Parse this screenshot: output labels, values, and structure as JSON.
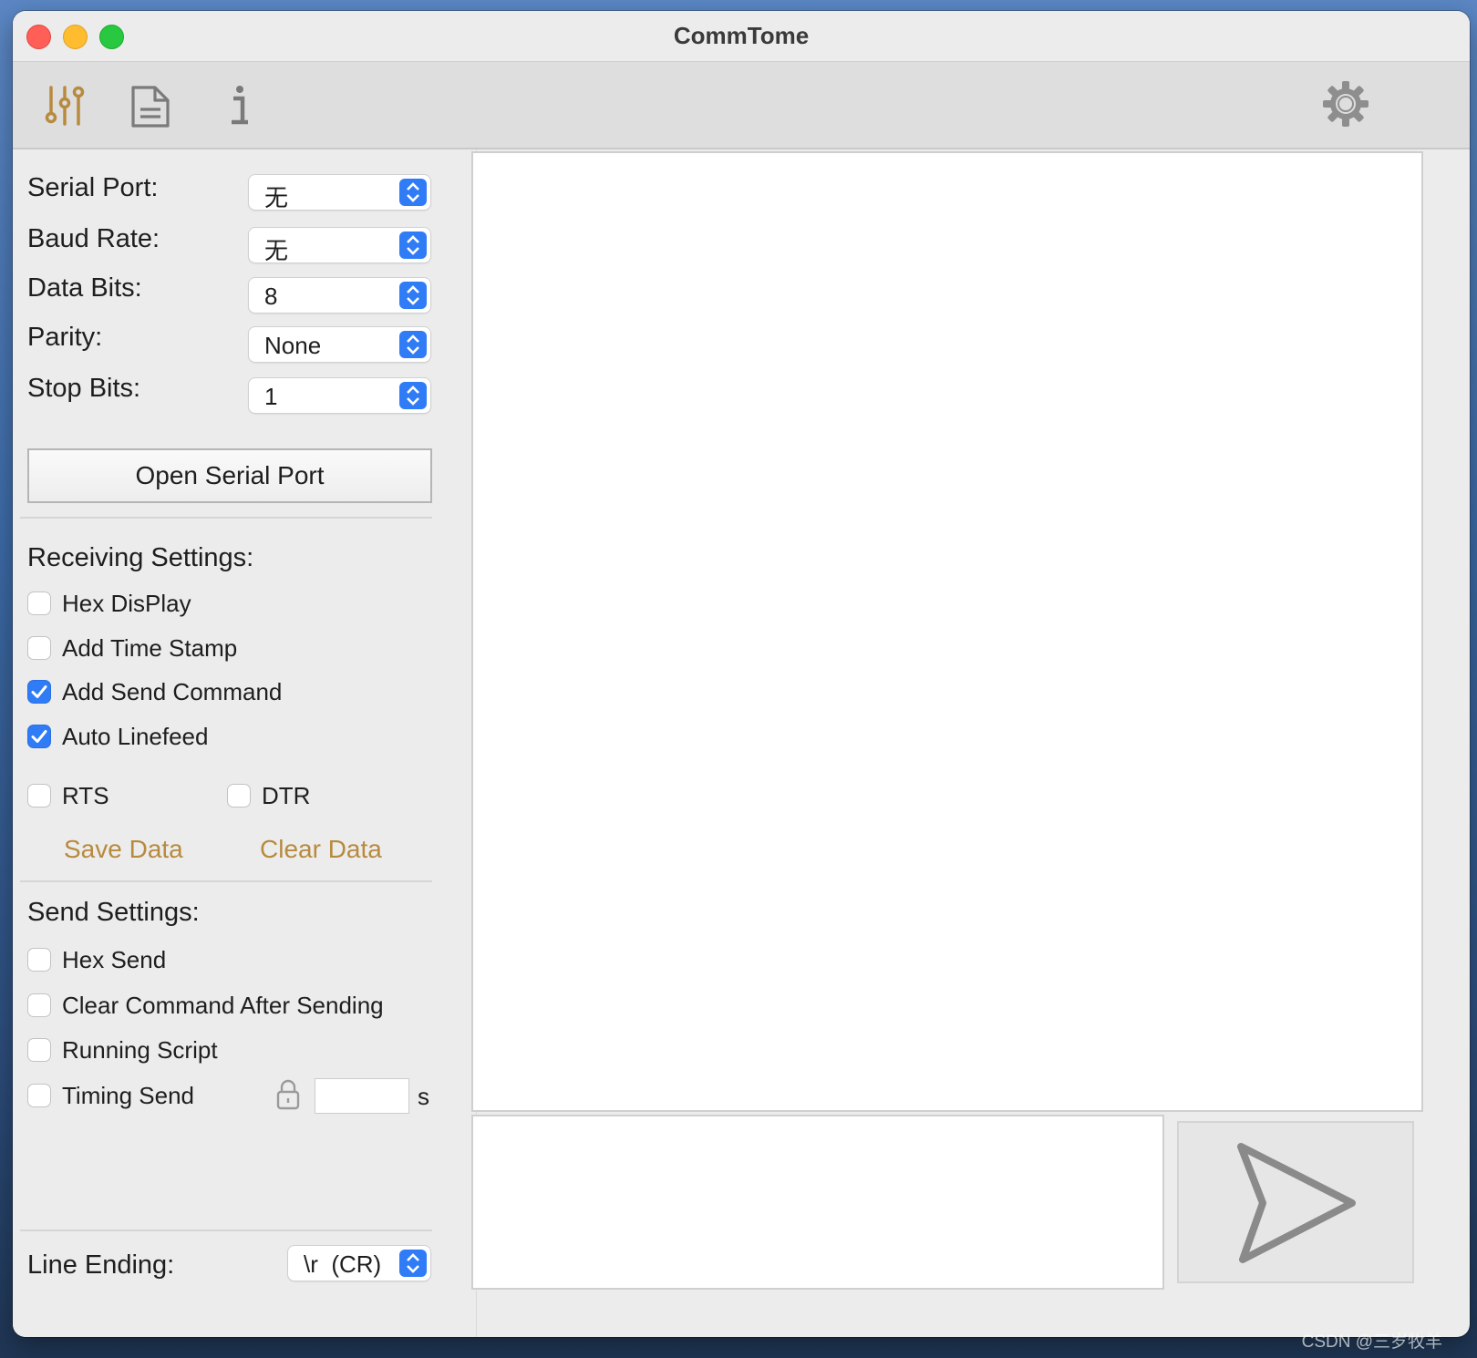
{
  "window": {
    "title": "CommTome"
  },
  "toolbar": {
    "left_icons": [
      "sliders-icon",
      "document-icon",
      "info-icon"
    ],
    "right_icon": "gear-icon",
    "active_color": "#b88a3e"
  },
  "serial": {
    "port_label": "Serial Port:",
    "port_value": "无",
    "baud_label": "Baud Rate:",
    "baud_value": "无",
    "databits_label": "Data Bits:",
    "databits_value": "8",
    "parity_label": "Parity:",
    "parity_value": "None",
    "stopbits_label": "Stop Bits:",
    "stopbits_value": "1",
    "open_button": "Open Serial Port"
  },
  "receiving": {
    "title": "Receiving Settings:",
    "options": [
      {
        "label": "Hex DisPlay",
        "checked": false
      },
      {
        "label": "Add Time Stamp",
        "checked": false
      },
      {
        "label": "Add Send Command",
        "checked": true
      },
      {
        "label": "Auto Linefeed",
        "checked": true
      }
    ],
    "rts_label": "RTS",
    "rts_checked": false,
    "dtr_label": "DTR",
    "dtr_checked": false,
    "save_label": "Save Data",
    "clear_label": "Clear Data"
  },
  "send": {
    "title": "Send Settings:",
    "options": [
      {
        "label": "Hex Send",
        "checked": false
      },
      {
        "label": "Clear Command After Sending",
        "checked": false
      },
      {
        "label": "Running Script",
        "checked": false
      },
      {
        "label": "Timing Send",
        "checked": false
      }
    ],
    "interval_value": "",
    "interval_unit": "s",
    "line_ending_label": "Line Ending:",
    "line_ending_value": "\\r  (CR)"
  },
  "colors": {
    "accent": "#2f7cf6",
    "link": "#b88a3e"
  },
  "watermark": "CSDN @三岁牧羊"
}
